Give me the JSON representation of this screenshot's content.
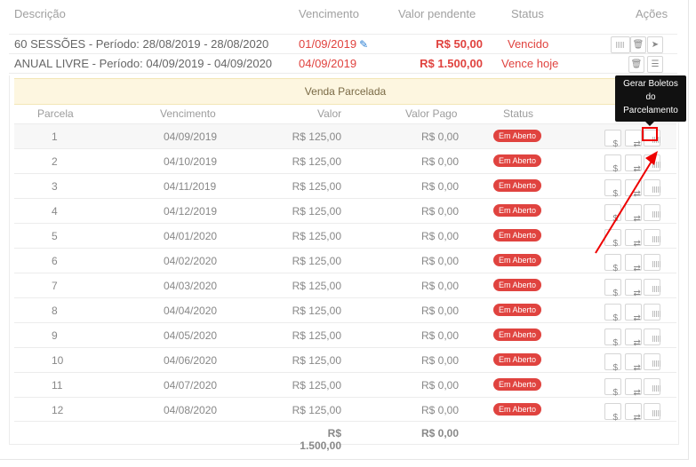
{
  "header": {
    "descricao": "Descrição",
    "vencimento": "Vencimento",
    "valor_pendente": "Valor pendente",
    "status": "Status",
    "acoes": "Ações"
  },
  "contracts": [
    {
      "descricao": "60 SESSÕES - Período: 28/08/2019 - 28/08/2020",
      "vencimento": "01/09/2019",
      "valor": "R$ 50,00",
      "status": "Vencido"
    },
    {
      "descricao": "ANUAL LIVRE - Período: 04/09/2019 - 04/09/2020",
      "vencimento": "04/09/2019",
      "valor": "R$ 1.500,00",
      "status": "Vence hoje"
    }
  ],
  "installments": {
    "banner": "Venda Parcelada",
    "headers": {
      "parcela": "Parcela",
      "vencimento": "Vencimento",
      "valor": "Valor",
      "valor_pago": "Valor Pago",
      "status": "Status"
    },
    "badge": "Em Aberto",
    "rows": [
      {
        "num": "1",
        "date": "04/09/2019",
        "valor": "R$ 125,00",
        "pago": "R$ 0,00"
      },
      {
        "num": "2",
        "date": "04/10/2019",
        "valor": "R$ 125,00",
        "pago": "R$ 0,00"
      },
      {
        "num": "3",
        "date": "04/11/2019",
        "valor": "R$ 125,00",
        "pago": "R$ 0,00"
      },
      {
        "num": "4",
        "date": "04/12/2019",
        "valor": "R$ 125,00",
        "pago": "R$ 0,00"
      },
      {
        "num": "5",
        "date": "04/01/2020",
        "valor": "R$ 125,00",
        "pago": "R$ 0,00"
      },
      {
        "num": "6",
        "date": "04/02/2020",
        "valor": "R$ 125,00",
        "pago": "R$ 0,00"
      },
      {
        "num": "7",
        "date": "04/03/2020",
        "valor": "R$ 125,00",
        "pago": "R$ 0,00"
      },
      {
        "num": "8",
        "date": "04/04/2020",
        "valor": "R$ 125,00",
        "pago": "R$ 0,00"
      },
      {
        "num": "9",
        "date": "04/05/2020",
        "valor": "R$ 125,00",
        "pago": "R$ 0,00"
      },
      {
        "num": "10",
        "date": "04/06/2020",
        "valor": "R$ 125,00",
        "pago": "R$ 0,00"
      },
      {
        "num": "11",
        "date": "04/07/2020",
        "valor": "R$ 125,00",
        "pago": "R$ 0,00"
      },
      {
        "num": "12",
        "date": "04/08/2020",
        "valor": "R$ 125,00",
        "pago": "R$ 0,00"
      }
    ],
    "total_valor": "R$ 1.500,00",
    "total_pago": "R$ 0,00"
  },
  "tooltip": {
    "line1": "Gerar Boletos",
    "line2": "do",
    "line3": "Parcelamento"
  },
  "icons": {
    "dollar": "$",
    "refresh": "⇄"
  },
  "colors": {
    "danger": "#e0433f",
    "banner": "#fdf6e0",
    "highlight": "#ee0000"
  }
}
